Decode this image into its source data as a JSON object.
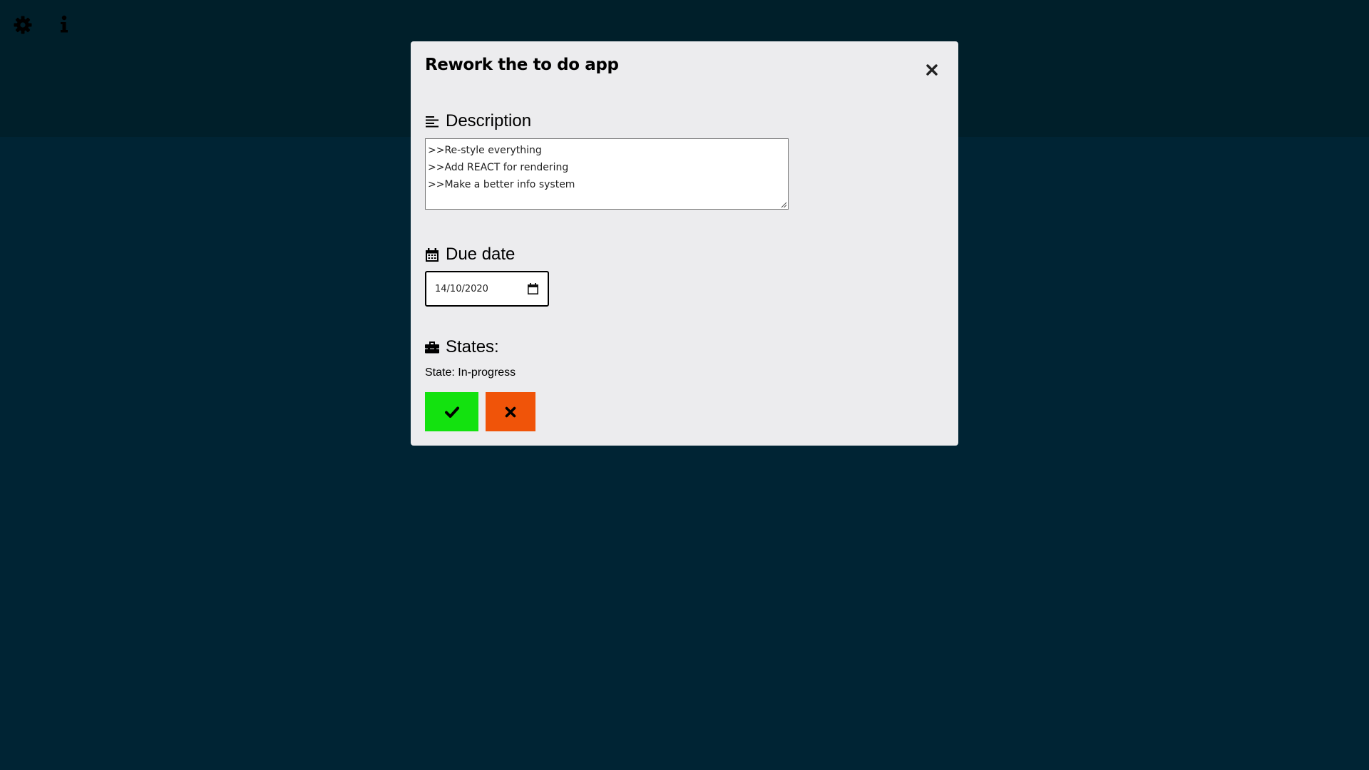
{
  "top_bar": {
    "settings_icon": "gear-icon",
    "info_icon": "info-icon"
  },
  "modal": {
    "title": "Rework the to do app",
    "close_icon": "close-icon",
    "description": {
      "heading": "Description",
      "icon": "align-left-icon",
      "value": ">>Re-style everything\n>>Add REACT for rendering\n>>Make a better info system"
    },
    "due_date": {
      "heading": "Due date",
      "icon": "calendar-icon",
      "value": "14/10/2020",
      "picker_icon": "calendar-picker-icon"
    },
    "states": {
      "heading": "States:",
      "icon": "toolbox-icon",
      "current": "State: In-progress",
      "done_icon": "check-icon",
      "cancel_icon": "close-icon"
    }
  },
  "colors": {
    "background": "#00222f",
    "modal_background": "#ececee",
    "done_button": "#13e20f",
    "cancel_button": "#f05409"
  }
}
